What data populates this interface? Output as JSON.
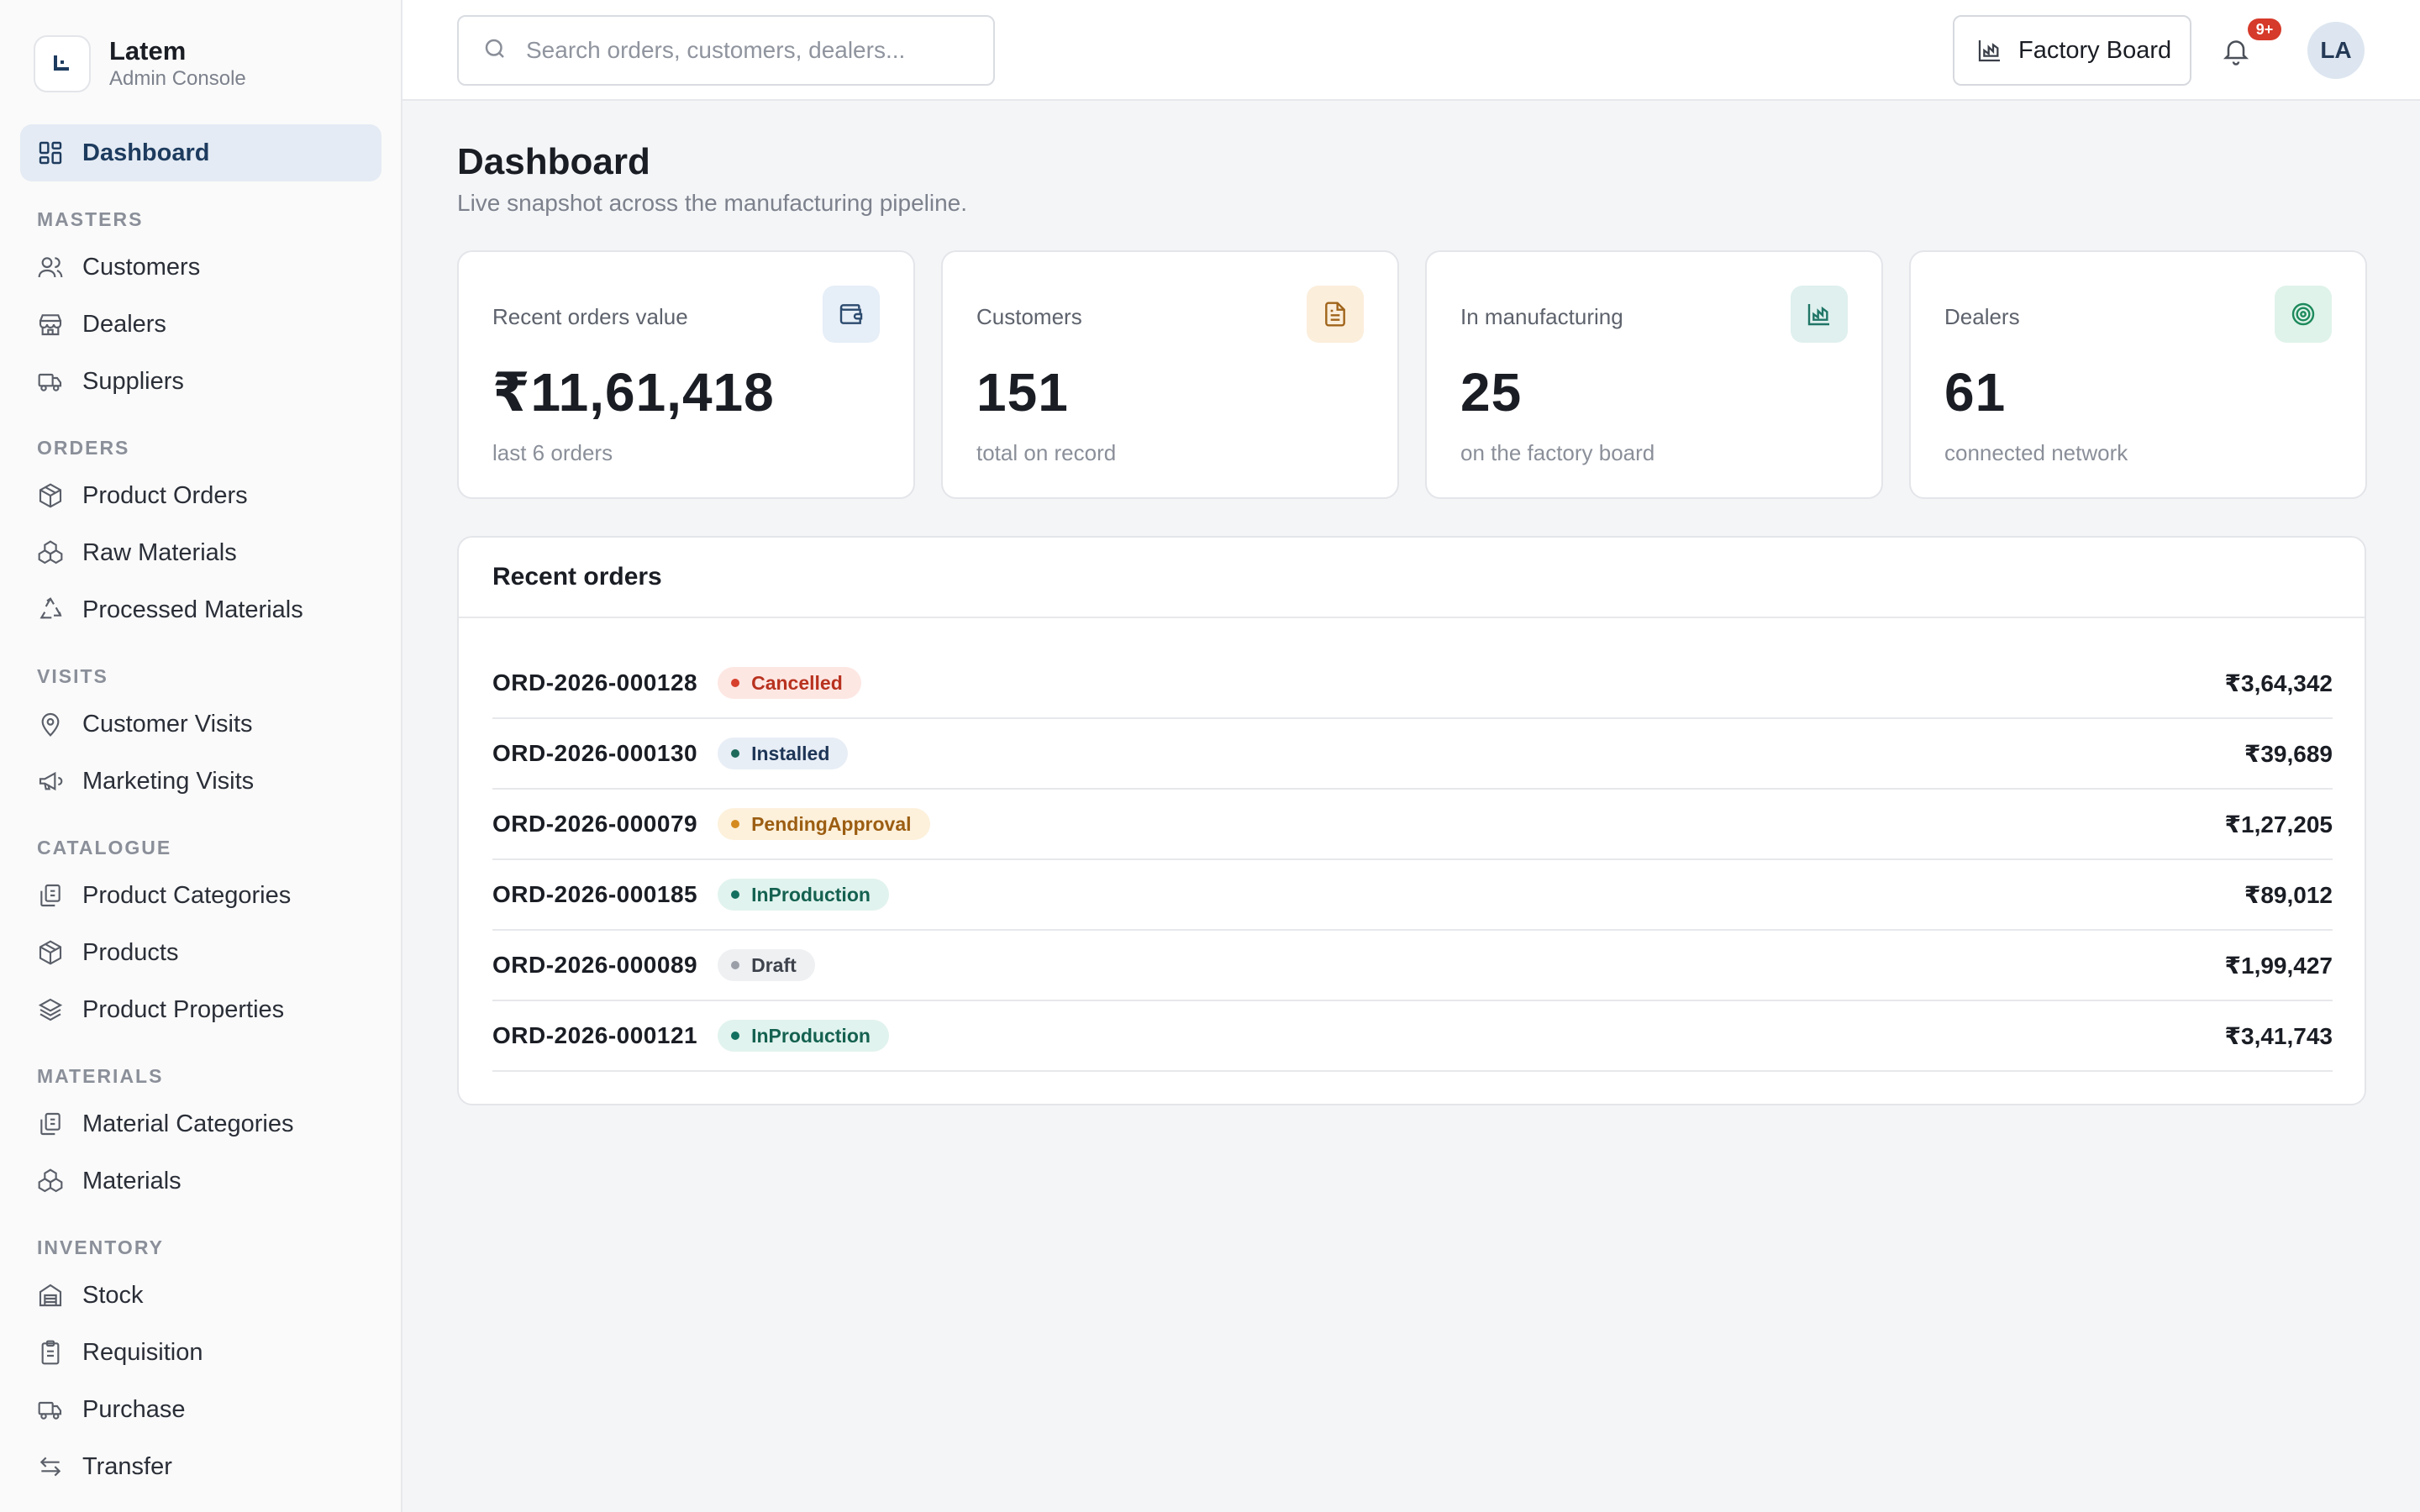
{
  "brand": {
    "name": "Latem",
    "subtitle": "Admin Console"
  },
  "sidebar": {
    "active": {
      "label": "Dashboard",
      "icon": "dashboard-icon"
    },
    "sections": [
      {
        "title": "MASTERS",
        "items": [
          {
            "label": "Customers",
            "icon": "users-icon"
          },
          {
            "label": "Dealers",
            "icon": "store-icon"
          },
          {
            "label": "Suppliers",
            "icon": "truck-icon"
          }
        ]
      },
      {
        "title": "ORDERS",
        "items": [
          {
            "label": "Product Orders",
            "icon": "package-icon"
          },
          {
            "label": "Raw Materials",
            "icon": "boxes-icon"
          },
          {
            "label": "Processed Materials",
            "icon": "recycle-icon"
          }
        ]
      },
      {
        "title": "VISITS",
        "items": [
          {
            "label": "Customer Visits",
            "icon": "map-pin-icon"
          },
          {
            "label": "Marketing Visits",
            "icon": "megaphone-icon"
          }
        ]
      },
      {
        "title": "CATALOGUE",
        "items": [
          {
            "label": "Product Categories",
            "icon": "copy-icon"
          },
          {
            "label": "Products",
            "icon": "package-icon"
          },
          {
            "label": "Product Properties",
            "icon": "layers-icon"
          }
        ]
      },
      {
        "title": "MATERIALS",
        "items": [
          {
            "label": "Material Categories",
            "icon": "copy-icon"
          },
          {
            "label": "Materials",
            "icon": "boxes-icon"
          }
        ]
      },
      {
        "title": "INVENTORY",
        "items": [
          {
            "label": "Stock",
            "icon": "warehouse-icon"
          },
          {
            "label": "Requisition",
            "icon": "clipboard-icon"
          },
          {
            "label": "Purchase",
            "icon": "truck-icon"
          },
          {
            "label": "Transfer",
            "icon": "arrows-exchange-icon"
          }
        ]
      }
    ]
  },
  "topbar": {
    "search_placeholder": "Search orders, customers, dealers...",
    "factory_board_label": "Factory Board",
    "notification_count": "9+",
    "avatar_initials": "LA"
  },
  "page": {
    "title": "Dashboard",
    "subtitle": "Live snapshot across the manufacturing pipeline."
  },
  "stats": [
    {
      "label": "Recent orders value",
      "value": "₹11,61,418",
      "note": "last 6 orders",
      "icon": "wallet-icon",
      "icon_bg": "#e6eef7",
      "icon_color": "#2b4a6e"
    },
    {
      "label": "Customers",
      "value": "151",
      "note": "total on record",
      "icon": "document-icon",
      "icon_bg": "#fbeedb",
      "icon_color": "#a0641a"
    },
    {
      "label": "In manufacturing",
      "value": "25",
      "note": "on the factory board",
      "icon": "factory-chart-icon",
      "icon_bg": "#dff0ee",
      "icon_color": "#1f7566"
    },
    {
      "label": "Dealers",
      "value": "61",
      "note": "connected network",
      "icon": "target-icon",
      "icon_bg": "#dff3ea",
      "icon_color": "#1d8a5c"
    }
  ],
  "recent_orders": {
    "title": "Recent orders",
    "rows": [
      {
        "id": "ORD-2026-000128",
        "status": "Cancelled",
        "amount": "₹3,64,342"
      },
      {
        "id": "ORD-2026-000130",
        "status": "Installed",
        "amount": "₹39,689"
      },
      {
        "id": "ORD-2026-000079",
        "status": "PendingApproval",
        "amount": "₹1,27,205"
      },
      {
        "id": "ORD-2026-000185",
        "status": "InProduction",
        "amount": "₹89,012"
      },
      {
        "id": "ORD-2026-000089",
        "status": "Draft",
        "amount": "₹1,99,427"
      },
      {
        "id": "ORD-2026-000121",
        "status": "InProduction",
        "amount": "₹3,41,743"
      }
    ]
  },
  "status_colors": {
    "Cancelled": {
      "bg": "#fde7e3",
      "fg": "#b8321f",
      "dot": "#d6402c"
    },
    "Installed": {
      "bg": "#e8eef6",
      "fg": "#1d3556",
      "dot": "#1f6a5a"
    },
    "PendingApproval": {
      "bg": "#fdf1dc",
      "fg": "#9c5e12",
      "dot": "#d48a1f"
    },
    "InProduction": {
      "bg": "#e1f3ee",
      "fg": "#146150",
      "dot": "#137060"
    },
    "Draft": {
      "bg": "#eef0f2",
      "fg": "#3d424b",
      "dot": "#9ba0a8"
    }
  }
}
